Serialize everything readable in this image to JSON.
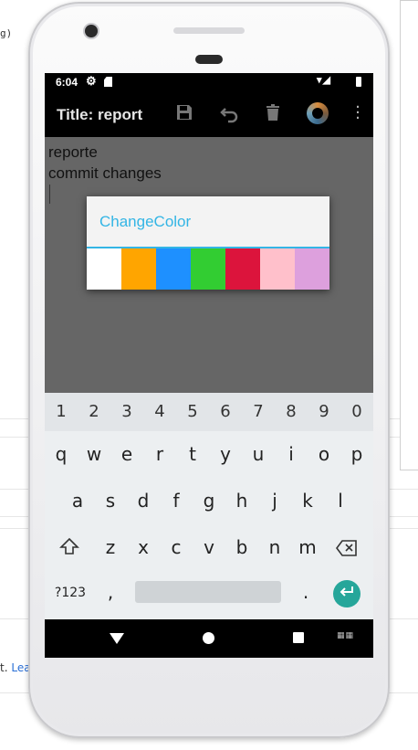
{
  "background": {
    "code_fragment": "g)",
    "footer_text": "t.",
    "footer_link": "Lea"
  },
  "status_bar": {
    "time": "6:04",
    "icons": [
      "gear-icon",
      "sd-card-icon",
      "wifi-icon",
      "signal-icon",
      "battery-icon"
    ]
  },
  "toolbar": {
    "title": "Title: report",
    "icons": [
      "save-icon",
      "undo-icon",
      "delete-icon",
      "color-wheel-icon",
      "more-vert-icon"
    ]
  },
  "note": {
    "line1": "reporte",
    "line2": "commit changes"
  },
  "dialog": {
    "title": "ChangeColor",
    "colors": [
      "#ffffff",
      "#ffa500",
      "#1e90ff",
      "#32cd32",
      "#dc143c",
      "#ffc0cb",
      "#dda0dd"
    ]
  },
  "keyboard": {
    "numbers": [
      "1",
      "2",
      "3",
      "4",
      "5",
      "6",
      "7",
      "8",
      "9",
      "0"
    ],
    "row1": [
      "q",
      "w",
      "e",
      "r",
      "t",
      "y",
      "u",
      "i",
      "o",
      "p"
    ],
    "row2": [
      "a",
      "s",
      "d",
      "f",
      "g",
      "h",
      "j",
      "k",
      "l"
    ],
    "row3": [
      "z",
      "x",
      "c",
      "v",
      "b",
      "n",
      "m"
    ],
    "symbols_key": "?123",
    "comma_key": ",",
    "period_key": "."
  },
  "colors": {
    "accent": "#33b5e5",
    "editor_bg": "#666666",
    "enter_key": "#26a69a"
  }
}
